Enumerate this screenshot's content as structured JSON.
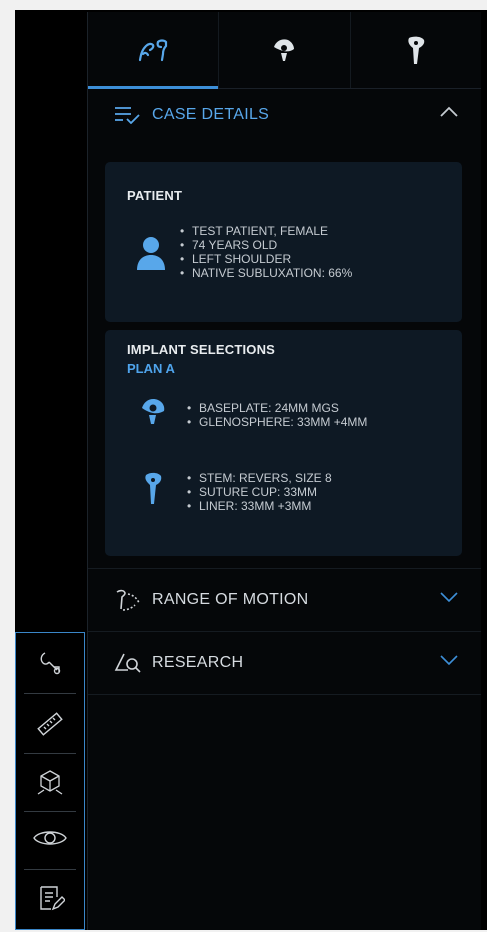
{
  "tabs": [
    {
      "icon": "surgery-tools-icon",
      "active": true
    },
    {
      "icon": "glenosphere-icon",
      "active": false
    },
    {
      "icon": "humeral-stem-icon",
      "active": false
    }
  ],
  "case_details": {
    "title": "CASE DETAILS",
    "icon": "checklist-icon",
    "expanded": true,
    "patient": {
      "title": "PATIENT",
      "icon": "user-icon",
      "lines": [
        "TEST PATIENT, FEMALE",
        "74 YEARS OLD",
        "LEFT SHOULDER",
        "NATIVE SUBLUXATION: 66%"
      ]
    },
    "implants": {
      "title": "IMPLANT SELECTIONS",
      "plan": "PLAN A",
      "glenoid_lines": [
        "BASEPLATE: 24MM MGS",
        "GLENOSPHERE: 33MM +4MM"
      ],
      "humeral_lines": [
        "STEM: REVERS, SIZE 8",
        "SUTURE CUP: 33MM",
        "LINER: 33MM  +3MM"
      ]
    }
  },
  "range_of_motion": {
    "title": "RANGE OF MOTION",
    "icon": "motion-arc-icon",
    "expanded": false
  },
  "research": {
    "title": "RESEARCH",
    "icon": "angle-search-icon",
    "expanded": false
  },
  "toolbar": [
    {
      "name": "lasso-tool",
      "icon": "lasso-icon"
    },
    {
      "name": "ruler-tool",
      "icon": "ruler-icon"
    },
    {
      "name": "cube-view-tool",
      "icon": "cube-icon"
    },
    {
      "name": "visibility-tool",
      "icon": "eye-icon"
    },
    {
      "name": "notes-tool",
      "icon": "notes-edit-icon"
    }
  ],
  "colors": {
    "accent": "#3d8fd8",
    "card_bg": "#0e1924",
    "panel_bg": "#050709",
    "text": "#d6dbe0"
  }
}
